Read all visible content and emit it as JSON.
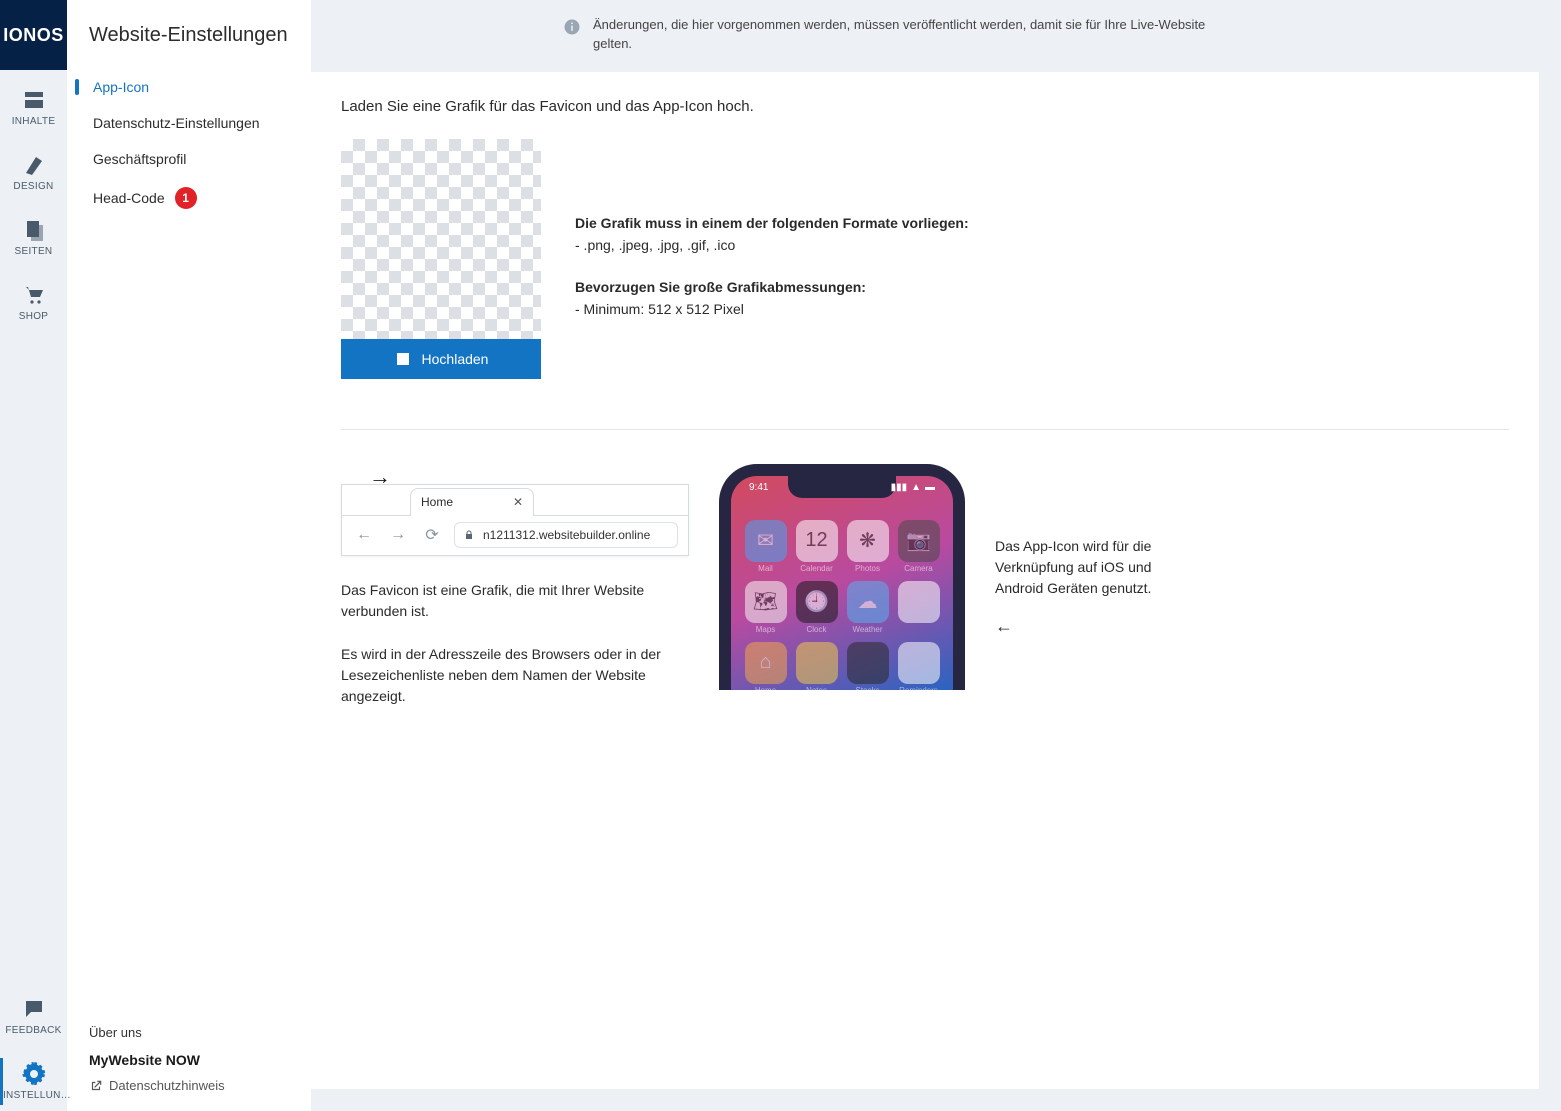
{
  "brand": "IONOS",
  "rail": {
    "items": [
      {
        "label": "INHALTE"
      },
      {
        "label": "DESIGN"
      },
      {
        "label": "SEITEN"
      },
      {
        "label": "SHOP"
      }
    ],
    "feedback": "FEEDBACK",
    "settings": "EINSTELLUN…"
  },
  "sidebar": {
    "title": "Website-Einstellungen",
    "items": [
      {
        "label": "App-Icon",
        "active": true
      },
      {
        "label": "Datenschutz-Einstellungen"
      },
      {
        "label": "Geschäftsprofil"
      },
      {
        "label": "Head-Code",
        "badge": "1"
      }
    ],
    "footer": {
      "about": "Über uns",
      "product": "MyWebsite NOW",
      "privacy": "Datenschutzhinweis"
    }
  },
  "notice": "Änderungen, die hier vorgenommen werden, müssen veröffentlicht werden, damit sie für Ihre Live-Website gelten.",
  "main": {
    "intro": "Laden Sie eine Grafik für das Favicon und das App-Icon hoch.",
    "upload_label": "Hochladen",
    "req_heading": "Die Grafik muss in einem der folgenden Formate vorliegen:",
    "req_formats": "- .png, .jpeg, .jpg, .gif, .ico",
    "size_heading": "Bevorzugen Sie große Grafikabmessungen:",
    "size_text": "- Minimum: 512 x 512 Pixel",
    "browser_tab": "Home",
    "browser_url": "n1211312.websitebuilder.online",
    "favicon_p1": "Das Favicon ist eine Grafik, die mit Ihrer Website verbunden ist.",
    "favicon_p2": "Es wird in der Adresszeile des Browsers oder in der Lesezeichenliste neben dem Namen der Website angezeigt.",
    "phone_time": "9:41",
    "phone_apps": [
      {
        "label": "Mail",
        "bg": "#4aa3f0",
        "glyph": "✉"
      },
      {
        "label": "Calendar",
        "bg": "#ffffff",
        "glyph": "12"
      },
      {
        "label": "Photos",
        "bg": "#ffffff",
        "glyph": "❋"
      },
      {
        "label": "Camera",
        "bg": "#4a4a4a",
        "glyph": "📷"
      },
      {
        "label": "Maps",
        "bg": "#f5f5f0",
        "glyph": "🗺"
      },
      {
        "label": "Clock",
        "bg": "#1a1a1a",
        "glyph": "🕘"
      },
      {
        "label": "Weather",
        "bg": "#58b0f0",
        "glyph": "☁"
      },
      {
        "label": "",
        "bg": "#ffffff",
        "glyph": ""
      },
      {
        "label": "Home",
        "bg": "#f2a64a",
        "glyph": "⌂"
      },
      {
        "label": "Notes",
        "bg": "#f2c94a",
        "glyph": ""
      },
      {
        "label": "Stocks",
        "bg": "#2a2a2a",
        "glyph": ""
      },
      {
        "label": "Reminders",
        "bg": "#ffffff",
        "glyph": ""
      }
    ],
    "app_icon_desc": "Das App-Icon wird für die Verknüpfung auf iOS und Android Geräten genutzt."
  }
}
